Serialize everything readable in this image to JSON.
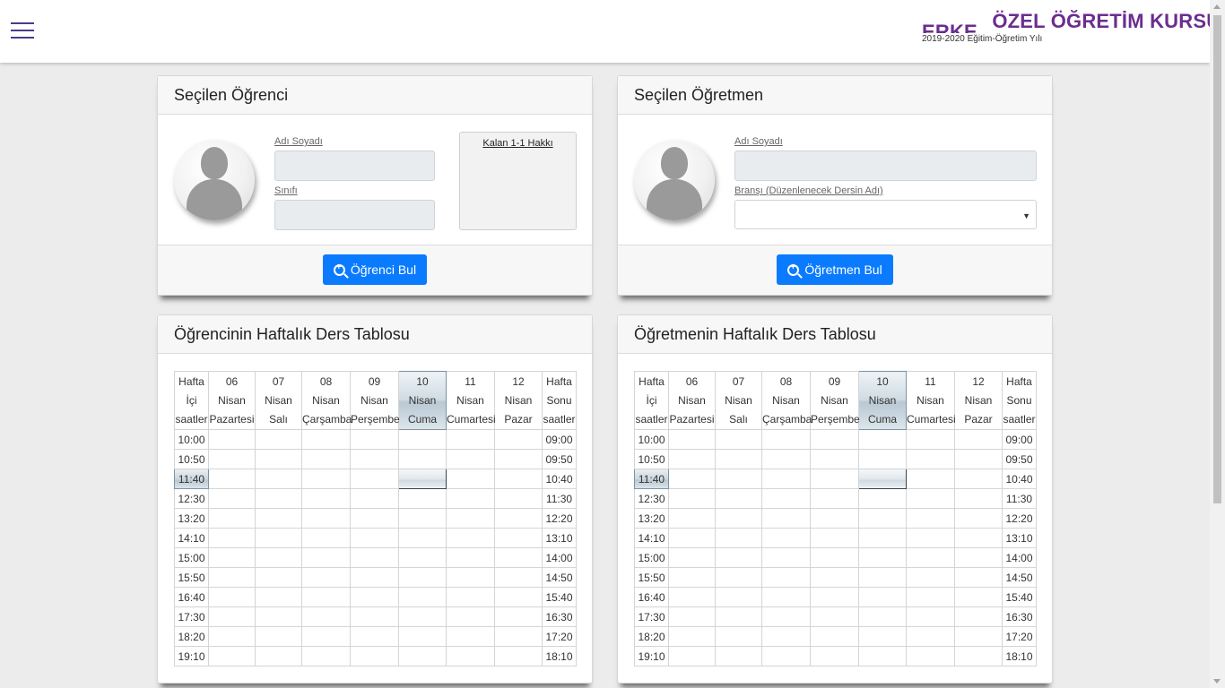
{
  "header": {
    "title": "ÖZEL ÖĞRETİM KURSU",
    "title_clipped": "ERKE",
    "subtitle": "2019-2020 Eğitim-Öğretim Yılı"
  },
  "student_card": {
    "title": "Seçilen Öğrenci",
    "name_label": "Adı Soyadı",
    "name_value": "",
    "class_label": "Sınıfı",
    "class_value": "",
    "remaining_label": "Kalan 1-1 Hakkı",
    "button_label": "Öğrenci Bul",
    "button_icon": "zoom-in-icon"
  },
  "teacher_card": {
    "title": "Seçilen Öğretmen",
    "name_label": "Adı Soyadı",
    "name_value": "",
    "branch_label": "Branşı (Düzenlenecek Dersin Adı)",
    "branch_selected": "",
    "button_label": "Öğretmen Bul",
    "button_icon": "zoom-in-icon"
  },
  "student_schedule": {
    "title": "Öğrencinin Haftalık Ders Tablosu"
  },
  "teacher_schedule": {
    "title": "Öğretmenin Haftalık Ders Tablosu"
  },
  "schedule": {
    "weekday_header": [
      "Hafta",
      "İçi",
      "saatler"
    ],
    "weekend_header": [
      "Hafta",
      "Sonu",
      "saatler"
    ],
    "days": [
      {
        "num": "06",
        "month": "Nisan",
        "name": "Pazartesi"
      },
      {
        "num": "07",
        "month": "Nisan",
        "name": "Salı"
      },
      {
        "num": "08",
        "month": "Nisan",
        "name": "Çarşamba"
      },
      {
        "num": "09",
        "month": "Nisan",
        "name": "Perşembe"
      },
      {
        "num": "10",
        "month": "Nisan",
        "name": "Cuma"
      },
      {
        "num": "11",
        "month": "Nisan",
        "name": "Cumartesi"
      },
      {
        "num": "12",
        "month": "Nisan",
        "name": "Pazar"
      }
    ],
    "today_index": 4,
    "weekday_times": [
      "10:00",
      "10:50",
      "11:40",
      "12:30",
      "13:20",
      "14:10",
      "15:00",
      "15:50",
      "16:40",
      "17:30",
      "18:20",
      "19:10"
    ],
    "weekend_times": [
      "09:00",
      "09:50",
      "10:40",
      "11:30",
      "12:20",
      "13:10",
      "14:00",
      "14:50",
      "15:40",
      "16:30",
      "17:20",
      "18:10"
    ],
    "selected_row": 2
  },
  "colors": {
    "brand": "#6b2d8f",
    "primary_button": "#0a7bff",
    "menu_icon": "#4b3a8c"
  }
}
